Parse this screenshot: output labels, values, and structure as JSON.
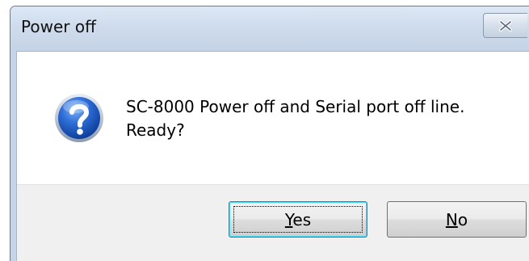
{
  "dialog": {
    "title": "Power off",
    "close_icon": "close-icon",
    "icon": "question-icon",
    "message_line1": "SC-8000 Power off and Serial port off line.",
    "message_line2": "Ready?",
    "buttons": {
      "yes": {
        "accel": "Y",
        "rest": "es"
      },
      "no": {
        "accel": "N",
        "rest": "o"
      }
    },
    "colors": {
      "titlebar": "#c4d3e6",
      "button_area": "#f0f0f0",
      "focus_border": "#3c7fb1",
      "icon_blue": "#1f57c3"
    }
  }
}
